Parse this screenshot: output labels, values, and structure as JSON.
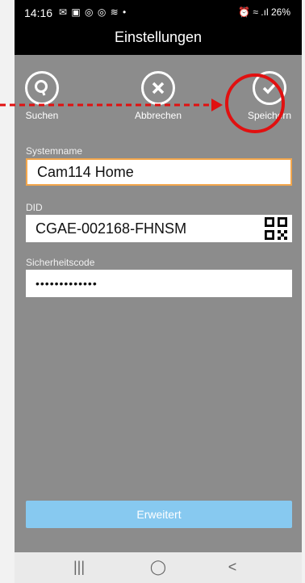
{
  "status_bar": {
    "time": "14:16",
    "notifications": "✉ ▣ ◎ ◎ ≋ •",
    "right": "⏰ ≈ .ıl 26%"
  },
  "header": {
    "title": "Einstellungen"
  },
  "toolbar": {
    "search_label": "Suchen",
    "cancel_label": "Abbrechen",
    "save_label": "Speichern"
  },
  "form": {
    "system_name": {
      "label": "Systemname",
      "value": "Cam114 Home"
    },
    "did": {
      "label": "DID",
      "value": "CGAE-002168-FHNSM"
    },
    "security_code": {
      "label": "Sicherheitscode",
      "value": "•••••••••••••"
    }
  },
  "advanced_button": {
    "label": "Erweitert"
  },
  "nav": {
    "recents": "|||",
    "home": "◯",
    "back": "<"
  },
  "colors": {
    "accent": "#87c9f0",
    "focus_border": "#f3a64b",
    "annotation": "#e11010"
  }
}
